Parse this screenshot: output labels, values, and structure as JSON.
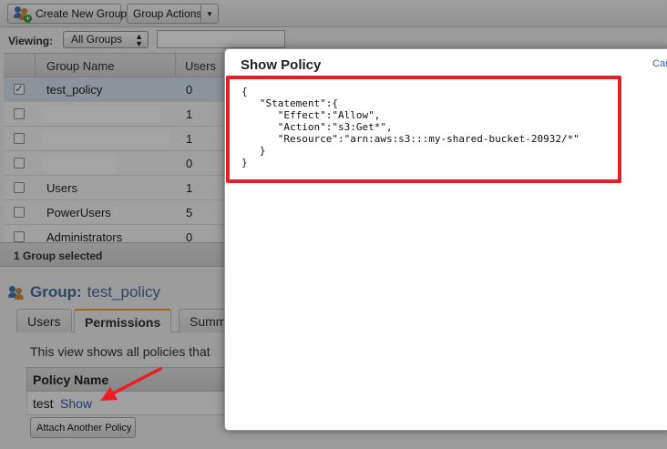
{
  "toolbar": {
    "create_group_label": "Create New Group",
    "group_actions_label": "Group Actions",
    "dropdown_caret": "▼"
  },
  "filter": {
    "viewing_label": "Viewing:",
    "selected_option": "All Groups",
    "search_value": ""
  },
  "groups_table": {
    "columns": [
      "Group Name",
      "Users"
    ],
    "rows": [
      {
        "name": "test_policy",
        "users": "0",
        "checked": true
      },
      {
        "name": "",
        "users": "1",
        "checked": false
      },
      {
        "name": "",
        "users": "1",
        "checked": false
      },
      {
        "name": "",
        "users": "0",
        "checked": false
      },
      {
        "name": "Users",
        "users": "1",
        "checked": false
      },
      {
        "name": "PowerUsers",
        "users": "5",
        "checked": false
      },
      {
        "name": "Administrators",
        "users": "0",
        "checked": false
      }
    ]
  },
  "selection": {
    "summary": "1 Group selected"
  },
  "group_detail": {
    "title_label": "Group:",
    "title_value": "test_policy",
    "tabs": [
      "Users",
      "Permissions",
      "Summary"
    ],
    "active_tab": "Permissions",
    "description": "This view shows all policies that",
    "policy_column": "Policy Name",
    "policies": [
      {
        "name": "test",
        "action": "Show"
      }
    ],
    "attach_button": "Attach Another Policy"
  },
  "dialog": {
    "title": "Show Policy",
    "cancel_label": "Cancel",
    "policy_text": "{\n   \"Statement\":{\n      \"Effect\":\"Allow\",\n      \"Action\":\"s3:Get*\",\n      \"Resource\":\"arn:aws:s3:::my-shared-bucket-20932/*\"\n   }\n}"
  },
  "colors": {
    "highlight_box": "#ec1c24",
    "link": "#2f64b0",
    "active_tab_accent": "#f0a030"
  }
}
